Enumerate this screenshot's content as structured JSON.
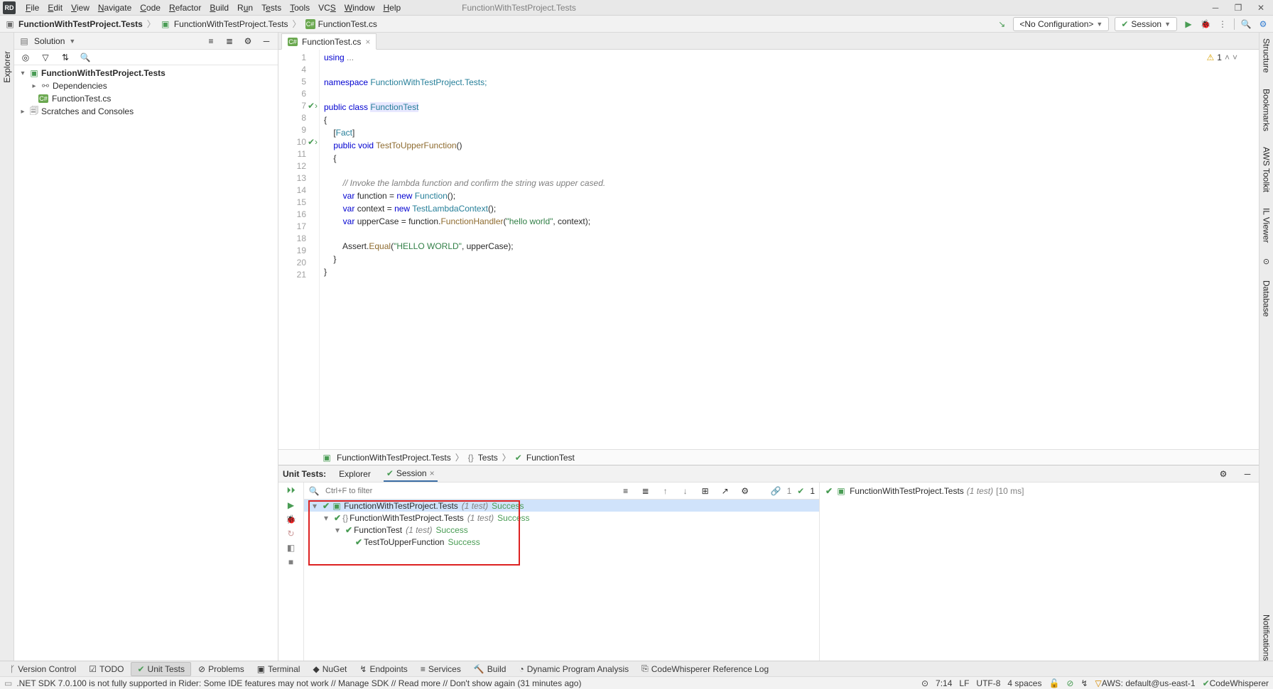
{
  "title_doc": "FunctionWithTestProject.Tests",
  "menu": [
    "File",
    "Edit",
    "View",
    "Navigate",
    "Code",
    "Refactor",
    "Build",
    "Run",
    "Tests",
    "Tools",
    "VCS",
    "Window",
    "Help"
  ],
  "breadcrumbs": [
    {
      "icon": "project",
      "label": "FunctionWithTestProject.Tests"
    },
    {
      "icon": "project",
      "label": "FunctionWithTestProject.Tests"
    },
    {
      "icon": "csharp",
      "label": "FunctionTest.cs"
    }
  ],
  "run_config": {
    "label": "<No Configuration>"
  },
  "session_btn": "Session",
  "solution": {
    "header": "Solution",
    "root": {
      "label": "FunctionWithTestProject.Tests"
    },
    "deps": "Dependencies",
    "file": "FunctionTest.cs",
    "scratches": "Scratches and Consoles"
  },
  "left_rail": "Explorer",
  "editor": {
    "tab": "FunctionTest.cs",
    "warnings": "1",
    "lines": [
      "1",
      "4",
      "5",
      "6",
      "7",
      "8",
      "9",
      "10",
      "11",
      "12",
      "13",
      "14",
      "15",
      "16",
      "17",
      "18",
      "19",
      "20",
      "21"
    ],
    "code": {
      "l1a": "using",
      "l1b": " ...",
      "l5a": "namespace",
      "l5b": " FunctionWithTestProject.Tests;",
      "l7a": "public class ",
      "l7b": "FunctionTest",
      "l8": "{",
      "l9a": "    [",
      "l9b": "Fact",
      "l9c": "]",
      "l10a": "    public void ",
      "l10b": "TestToUpperFunction",
      "l10c": "()",
      "l11": "    {",
      "l13": "        // Invoke the lambda function and confirm the string was upper cased.",
      "l14a": "        var ",
      "l14b": "function = ",
      "l14c": "new ",
      "l14d": "Function",
      "l14e": "();",
      "l15a": "        var ",
      "l15b": "context = ",
      "l15c": "new ",
      "l15d": "TestLambdaContext",
      "l15e": "();",
      "l16a": "        var ",
      "l16b": "upperCase = function.",
      "l16c": "FunctionHandler",
      "l16d": "(",
      "l16e": "\"hello world\"",
      "l16f": ", context);",
      "l18a": "        Assert.",
      "l18b": "Equal",
      "l18c": "(",
      "l18d": "\"HELLO WORLD\"",
      "l18e": ", upperCase);",
      "l19": "    }",
      "l20": "}"
    },
    "bc": [
      {
        "icon": "project",
        "label": "FunctionWithTestProject.Tests"
      },
      {
        "icon": "ns",
        "label": "Tests"
      },
      {
        "icon": "class",
        "label": "FunctionTest"
      }
    ]
  },
  "right_rail": [
    "Structure",
    "Bookmarks",
    "AWS Toolkit",
    "IL Viewer",
    "GitHub Copilot",
    "Database"
  ],
  "unit_tests": {
    "title": "Unit Tests:",
    "tabs": [
      "Explorer",
      "Session"
    ],
    "filter_placeholder": "Ctrl+F to filter",
    "pass_count": "1",
    "tree": [
      {
        "indent": 0,
        "exp": "▾",
        "icon": "project",
        "label": "FunctionWithTestProject.Tests",
        "count": "(1 test)",
        "status": "Success",
        "sel": true
      },
      {
        "indent": 1,
        "exp": "▾",
        "icon": "ns",
        "label": "FunctionWithTestProject.Tests",
        "count": "(1 test)",
        "status": "Success"
      },
      {
        "indent": 2,
        "exp": "▾",
        "icon": "",
        "label": "FunctionTest",
        "count": "(1 test)",
        "status": "Success"
      },
      {
        "indent": 3,
        "exp": "",
        "icon": "",
        "label": "TestToUpperFunction",
        "count": "",
        "status": "Success"
      }
    ],
    "output": {
      "label": "FunctionWithTestProject.Tests",
      "count": "(1 test)",
      "time": "[10 ms]"
    }
  },
  "tool_windows": [
    {
      "icon": "branch",
      "label": "Version Control"
    },
    {
      "icon": "todo",
      "label": "TODO"
    },
    {
      "icon": "tests",
      "label": "Unit Tests",
      "active": true
    },
    {
      "icon": "warn",
      "label": "Problems"
    },
    {
      "icon": "term",
      "label": "Terminal"
    },
    {
      "icon": "nuget",
      "label": "NuGet"
    },
    {
      "icon": "endpoint",
      "label": "Endpoints"
    },
    {
      "icon": "services",
      "label": "Services"
    },
    {
      "icon": "build",
      "label": "Build"
    },
    {
      "icon": "dpa",
      "label": "Dynamic Program Analysis"
    },
    {
      "icon": "cw",
      "label": "CodeWhisperer Reference Log"
    }
  ],
  "status": {
    "msg": ".NET SDK 7.0.100 is not fully supported in Rider: Some IDE features may not work // Manage SDK // Read more // Don't show again (31 minutes ago)",
    "pos": "7:14",
    "eol": "LF",
    "enc": "UTF-8",
    "indent": "4 spaces",
    "aws": "AWS: default@us-east-1",
    "cw": "CodeWhisperer"
  },
  "notifications_label": "Notifications"
}
